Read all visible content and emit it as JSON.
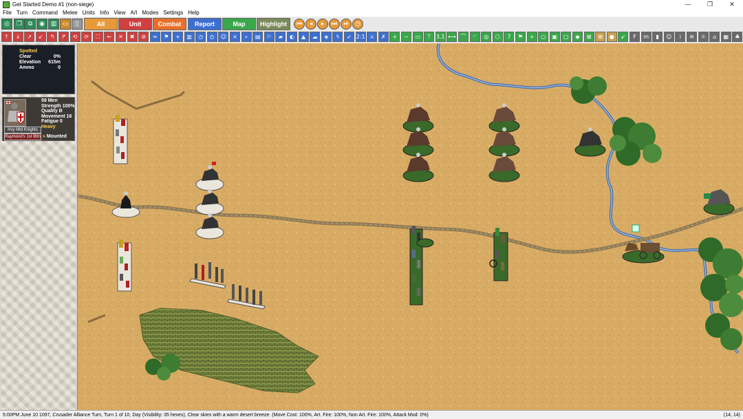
{
  "window": {
    "title": "Get Started Demo #1 (non-siege)",
    "minimize": "—",
    "maximize": "❐",
    "close": "✕"
  },
  "menu": [
    "File",
    "Turn",
    "Command",
    "Melee",
    "Units",
    "Info",
    "View",
    "A/I",
    "Modes",
    "Settings",
    "Help"
  ],
  "toolbar1": {
    "tabs": [
      {
        "label": "All",
        "color": "#e89a3a"
      },
      {
        "label": "Unit",
        "color": "#d04040"
      },
      {
        "label": "Combat",
        "color": "#e8702a"
      },
      {
        "label": "Report",
        "color": "#3c6fd0"
      },
      {
        "label": "Map",
        "color": "#3aa84a"
      },
      {
        "label": "Highlight",
        "color": "#7a8a5a"
      }
    ],
    "left_icons": [
      "target-icon",
      "layers-icon",
      "copy-icon",
      "eye-icon",
      "book-icon",
      "display-icon",
      "lock-icon"
    ],
    "nav_icons": [
      "first-turn-icon",
      "prev-turn-icon",
      "next-turn-icon",
      "last-turn-icon",
      "step-icon",
      "clock-icon"
    ]
  },
  "toolbar2": {
    "ratio_label": "2:1",
    "range_label": "3.1",
    "count_label": "7",
    "icons": [
      "arrow-up-icon",
      "arrow-down-icon",
      "arrow-up-right-icon",
      "arrow-down-left-icon",
      "turn-left-icon",
      "turn-right-icon",
      "wheel-left-icon",
      "wheel-right-icon",
      "fullscreen-icon",
      "arrow-left-icon",
      "cross-swords-icon",
      "close-icon",
      "block-icon",
      "wind-icon",
      "flag-icon",
      "plus-icon",
      "book-icon",
      "clock-icon",
      "alarm-icon",
      "disband-icon",
      "cross-icon",
      "search-icon",
      "clipboard-icon",
      "rally-icon",
      "banner-icon",
      "moon-icon",
      "fire-icon",
      "cloud-icon",
      "shield-icon",
      "lightning-icon",
      "arrow-icon",
      "melee-icon",
      "cancel-icon",
      "plus-icon",
      "minus-icon",
      "screen-icon",
      "signpost-icon",
      "distance-icon",
      "bridge-icon",
      "curve-icon",
      "target-icon",
      "hex-icon",
      "flag-icon",
      "plus-icon",
      "circle-icon",
      "label-icon",
      "frame-icon",
      "diamond-icon",
      "terrain-icon",
      "grid-icon",
      "coin-icon",
      "bird-icon",
      "F-icon",
      "m-icon",
      "lock-icon",
      "face-icon",
      "info-icon",
      "water-icon",
      "weather-icon",
      "village-icon",
      "building-icon",
      "tree-icon",
      "hierarchy-icon"
    ]
  },
  "terrain_info": {
    "spotted": "Spotted",
    "rows": [
      {
        "label": "Clear",
        "value": "0%"
      },
      {
        "label": "Elevation",
        "value": "615m"
      },
      {
        "label": "Ammo",
        "value": "0"
      }
    ]
  },
  "unit_info": {
    "men": "59 Men",
    "strength": "Strength 100%",
    "quality": "Quality B",
    "movement": "Movement 16",
    "fatigue": "Fatigue 0",
    "type": "Heavy",
    "name": "Hvy Mtd Knights",
    "leader": "Raymond's 1st Bttn",
    "mode": "Mounted",
    "mode_icon": "chevrons-icon"
  },
  "status": {
    "text": "5:00PM June 10 1097, Crusader Alliance Turn, Turn 1 of 10, Day (Visibility: 35 hexes), Clear skies with a warm desert breeze. (Move Cost: 100%, Art. Fire: 100%, Non Art. Fire: 100%, Attack Mod: 0%)",
    "coords": "(14, 14)"
  },
  "colors": {
    "desert": "#d8ab64",
    "river": "#4c74b0",
    "road": "#8e7a55",
    "forest": "#2f6a28",
    "field": "#6a7a3a"
  }
}
